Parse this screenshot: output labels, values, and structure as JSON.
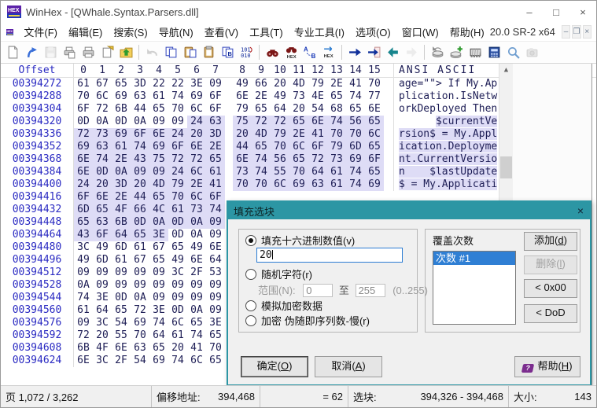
{
  "window": {
    "title": "WinHex - [QWhale.Syntax.Parsers.dll]",
    "controls": {
      "minimize": "–",
      "maximize": "□",
      "close": "×"
    }
  },
  "menubar": {
    "items": [
      "文件(F)",
      "编辑(E)",
      "搜索(S)",
      "导航(N)",
      "查看(V)",
      "工具(T)",
      "专业工具(I)",
      "选项(O)",
      "窗口(W)",
      "帮助(H)"
    ],
    "version": "20.0 SR-2 x64",
    "mdi_controls": {
      "minimize": "–",
      "restore": "❐",
      "close": "×"
    }
  },
  "toolbar": {
    "groups": [
      [
        {
          "name": "new-file-icon",
          "disabled": false
        },
        {
          "name": "open-file-icon",
          "disabled": false
        },
        {
          "name": "save-file-icon",
          "disabled": true
        },
        {
          "name": "print-preview-icon",
          "disabled": false
        },
        {
          "name": "print-icon",
          "disabled": false
        },
        {
          "name": "properties-icon",
          "disabled": false
        },
        {
          "name": "folder-up-icon",
          "disabled": false
        }
      ],
      [
        {
          "name": "undo-icon",
          "disabled": true
        },
        {
          "name": "copy-icon",
          "disabled": false
        },
        {
          "name": "paste-write-icon",
          "disabled": false
        },
        {
          "name": "paste-icon",
          "disabled": false
        },
        {
          "name": "copy-hex-icon",
          "disabled": false
        },
        {
          "name": "binary-convert-icon",
          "disabled": false
        }
      ],
      [
        {
          "name": "find-icon",
          "disabled": false
        },
        {
          "name": "find-hex-icon",
          "disabled": false
        },
        {
          "name": "replace-icon",
          "disabled": false
        },
        {
          "name": "replace-hex-icon",
          "disabled": false
        }
      ],
      [
        {
          "name": "goto-icon",
          "disabled": false
        },
        {
          "name": "goto-offset-icon",
          "disabled": false
        },
        {
          "name": "back-icon",
          "disabled": false
        },
        {
          "name": "forward-icon",
          "disabled": true
        }
      ],
      [
        {
          "name": "disk-undo-icon",
          "disabled": false
        },
        {
          "name": "disk-add-icon",
          "disabled": false
        },
        {
          "name": "ram-editor-icon",
          "disabled": false
        },
        {
          "name": "calculator-icon",
          "disabled": false
        },
        {
          "name": "magnifier-icon",
          "disabled": false
        },
        {
          "name": "camera-icon",
          "disabled": true
        }
      ]
    ]
  },
  "hex_editor": {
    "header": {
      "offset": "Offset",
      "cols": [
        "0",
        "1",
        "2",
        "3",
        "4",
        "5",
        "6",
        "7",
        "8",
        "9",
        "10",
        "11",
        "12",
        "13",
        "14",
        "15"
      ],
      "ascii": "ANSI ASCII"
    },
    "rows": [
      {
        "offset": "00394272",
        "bytes": [
          "61",
          "67",
          "65",
          "3D",
          "22",
          "22",
          "3E",
          "09",
          "49",
          "66",
          "20",
          "4D",
          "79",
          "2E",
          "41",
          "70"
        ],
        "ascii": "age=\"\"> If My.Ap",
        "sel": null
      },
      {
        "offset": "00394288",
        "bytes": [
          "70",
          "6C",
          "69",
          "63",
          "61",
          "74",
          "69",
          "6F",
          "6E",
          "2E",
          "49",
          "73",
          "4E",
          "65",
          "74",
          "77"
        ],
        "ascii": "plication.IsNetw",
        "sel": null
      },
      {
        "offset": "00394304",
        "bytes": [
          "6F",
          "72",
          "6B",
          "44",
          "65",
          "70",
          "6C",
          "6F",
          "79",
          "65",
          "64",
          "20",
          "54",
          "68",
          "65",
          "6E"
        ],
        "ascii": "orkDeployed Then",
        "sel": null
      },
      {
        "offset": "00394320",
        "bytes": [
          "0D",
          "0A",
          "0D",
          "0A",
          "09",
          "09",
          "24",
          "63",
          "75",
          "72",
          "72",
          "65",
          "6E",
          "74",
          "56",
          "65"
        ],
        "ascii": "      $currentVe",
        "sel": [
          6,
          16
        ]
      },
      {
        "offset": "00394336",
        "bytes": [
          "72",
          "73",
          "69",
          "6F",
          "6E",
          "24",
          "20",
          "3D",
          "20",
          "4D",
          "79",
          "2E",
          "41",
          "70",
          "70",
          "6C"
        ],
        "ascii": "rsion$ = My.Appl",
        "sel": [
          0,
          16
        ]
      },
      {
        "offset": "00394352",
        "bytes": [
          "69",
          "63",
          "61",
          "74",
          "69",
          "6F",
          "6E",
          "2E",
          "44",
          "65",
          "70",
          "6C",
          "6F",
          "79",
          "6D",
          "65"
        ],
        "ascii": "ication.Deployme",
        "sel": [
          0,
          16
        ]
      },
      {
        "offset": "00394368",
        "bytes": [
          "6E",
          "74",
          "2E",
          "43",
          "75",
          "72",
          "72",
          "65",
          "6E",
          "74",
          "56",
          "65",
          "72",
          "73",
          "69",
          "6F"
        ],
        "ascii": "nt.CurrentVersio",
        "sel": [
          0,
          16
        ]
      },
      {
        "offset": "00394384",
        "bytes": [
          "6E",
          "0D",
          "0A",
          "09",
          "09",
          "24",
          "6C",
          "61",
          "73",
          "74",
          "55",
          "70",
          "64",
          "61",
          "74",
          "65"
        ],
        "ascii": "n    $lastUpdate",
        "sel": [
          0,
          16
        ]
      },
      {
        "offset": "00394400",
        "bytes": [
          "24",
          "20",
          "3D",
          "20",
          "4D",
          "79",
          "2E",
          "41",
          "70",
          "70",
          "6C",
          "69",
          "63",
          "61",
          "74",
          "69"
        ],
        "ascii": "$ = My.Applicati",
        "sel": [
          0,
          16
        ]
      },
      {
        "offset": "00394416",
        "bytes": [
          "6F",
          "6E",
          "2E",
          "44",
          "65",
          "70",
          "6C",
          "6F"
        ],
        "ascii": null,
        "sel": [
          0,
          8
        ]
      },
      {
        "offset": "00394432",
        "bytes": [
          "6D",
          "65",
          "4F",
          "66",
          "4C",
          "61",
          "73",
          "74"
        ],
        "ascii": null,
        "sel": [
          0,
          8
        ]
      },
      {
        "offset": "00394448",
        "bytes": [
          "65",
          "63",
          "6B",
          "0D",
          "0A",
          "0D",
          "0A",
          "09"
        ],
        "ascii": null,
        "sel": [
          0,
          8
        ]
      },
      {
        "offset": "00394464",
        "bytes": [
          "43",
          "6F",
          "64",
          "65",
          "3E",
          "0D",
          "0A",
          "09"
        ],
        "ascii": null,
        "sel": [
          0,
          5
        ]
      },
      {
        "offset": "00394480",
        "bytes": [
          "3C",
          "49",
          "6D",
          "61",
          "67",
          "65",
          "49",
          "6E"
        ],
        "ascii": null,
        "sel": null
      },
      {
        "offset": "00394496",
        "bytes": [
          "49",
          "6D",
          "61",
          "67",
          "65",
          "49",
          "6E",
          "64"
        ],
        "ascii": null,
        "sel": null
      },
      {
        "offset": "00394512",
        "bytes": [
          "09",
          "09",
          "09",
          "09",
          "09",
          "3C",
          "2F",
          "53"
        ],
        "ascii": null,
        "sel": null
      },
      {
        "offset": "00394528",
        "bytes": [
          "0A",
          "09",
          "09",
          "09",
          "09",
          "09",
          "09",
          "09"
        ],
        "ascii": null,
        "sel": null
      },
      {
        "offset": "00394544",
        "bytes": [
          "74",
          "3E",
          "0D",
          "0A",
          "09",
          "09",
          "09",
          "09"
        ],
        "ascii": null,
        "sel": null
      },
      {
        "offset": "00394560",
        "bytes": [
          "61",
          "64",
          "65",
          "72",
          "3E",
          "0D",
          "0A",
          "09"
        ],
        "ascii": null,
        "sel": null
      },
      {
        "offset": "00394576",
        "bytes": [
          "09",
          "3C",
          "54",
          "69",
          "74",
          "6C",
          "65",
          "3E"
        ],
        "ascii": null,
        "sel": null
      },
      {
        "offset": "00394592",
        "bytes": [
          "72",
          "20",
          "55",
          "70",
          "64",
          "61",
          "74",
          "65"
        ],
        "ascii": null,
        "sel": null
      },
      {
        "offset": "00394608",
        "bytes": [
          "6B",
          "4F",
          "6E",
          "63",
          "65",
          "20",
          "41",
          "70"
        ],
        "ascii": null,
        "sel": null
      },
      {
        "offset": "00394624",
        "bytes": [
          "6E",
          "3C",
          "2F",
          "54",
          "69",
          "74",
          "6C",
          "65"
        ],
        "ascii": null,
        "sel": null
      }
    ]
  },
  "dialog": {
    "title": "填充选块",
    "close": "×",
    "fill_group": {
      "radios": [
        {
          "label": "填充十六进制数值(v)",
          "selected": true
        },
        {
          "label": "随机字符(r)",
          "selected": false
        },
        {
          "label": "模拟加密数据",
          "selected": false
        },
        {
          "label": "加密 伪随即序列数-慢(r)",
          "selected": false
        }
      ],
      "hex_value": "20",
      "range": {
        "label": "范围(N):",
        "from": "0",
        "to_label": "至",
        "to": "255",
        "hint": "(0..255)"
      }
    },
    "passes_group": {
      "label": "覆盖次数",
      "list": [
        "次数 #1"
      ],
      "selected_index": 0,
      "buttons": [
        {
          "label": "添加(d)",
          "disabled": false
        },
        {
          "label": "删除(l)",
          "disabled": true
        },
        {
          "label": "< 0x00",
          "disabled": false
        },
        {
          "label": "< DoD",
          "disabled": false
        }
      ]
    },
    "buttons": {
      "ok": "确定(O)",
      "cancel": "取消(A)",
      "help": "帮助(H)"
    }
  },
  "status_bar": {
    "page": "页 1,072 / 3,262",
    "offset_label": "偏移地址:",
    "offset_value": "394,468",
    "equals": "= 62",
    "block_label": "选块:",
    "block_value": "394,326 - 394,468",
    "size_label": "大小:",
    "size_value": "143"
  }
}
